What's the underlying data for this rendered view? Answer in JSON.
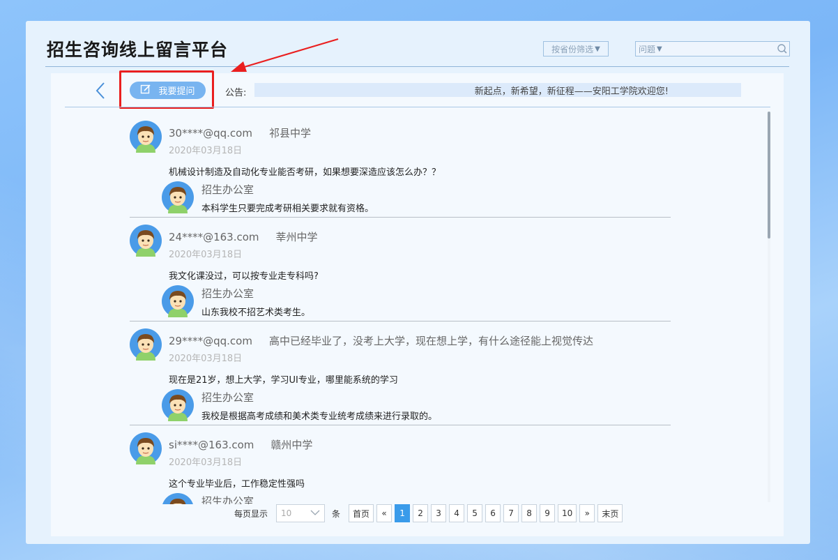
{
  "header": {
    "title": "招生咨询线上留言平台",
    "province_filter": "按省份筛选",
    "search_type": "问题",
    "search_placeholder": ""
  },
  "toolbar": {
    "ask_label": "我要提问",
    "notice_label": "公告:",
    "notice_text": "新起点，新希望，新征程——安阳工学院欢迎您!"
  },
  "messages": [
    {
      "user": "30****@qq.com",
      "school": "祁县中学",
      "date": "2020年03月18日",
      "question": "机械设计制造及自动化专业能否考研，如果想要深造应该怎么办？？",
      "office": "招生办公室",
      "answer": "本科学生只要完成考研相关要求就有资格。"
    },
    {
      "user": "24****@163.com",
      "school": "莘州中学",
      "date": "2020年03月18日",
      "question": "我文化课没过，可以按专业走专科吗?",
      "office": "招生办公室",
      "answer": "山东我校不招艺术类考生。"
    },
    {
      "user": "29****@qq.com",
      "school": "高中已经毕业了，没考上大学，现在想上学，有什么途径能上视觉传达",
      "date": "2020年03月18日",
      "question": "现在是21岁，想上大学，学习UI专业，哪里能系统的学习",
      "office": "招生办公室",
      "answer": "我校是根据高考成绩和美术类专业统考成绩来进行录取的。"
    },
    {
      "user": "si****@163.com",
      "school": "赣州中学",
      "date": "2020年03月18日",
      "question": "这个专业毕业后，工作稳定性强吗",
      "office": "招生办公室",
      "answer": ""
    }
  ],
  "pagination": {
    "per_page_label": "每页显示",
    "per_page_value": "10",
    "unit_label": "条",
    "first": "首页",
    "prev": "«",
    "pages": [
      "1",
      "2",
      "3",
      "4",
      "5",
      "6",
      "7",
      "8",
      "9",
      "10"
    ],
    "active_page": "1",
    "next": "»",
    "last": "末页"
  },
  "colors": {
    "accent": "#3a9bea",
    "ask_button": "#78b4f0",
    "annotation_red": "#ea1f1f"
  }
}
